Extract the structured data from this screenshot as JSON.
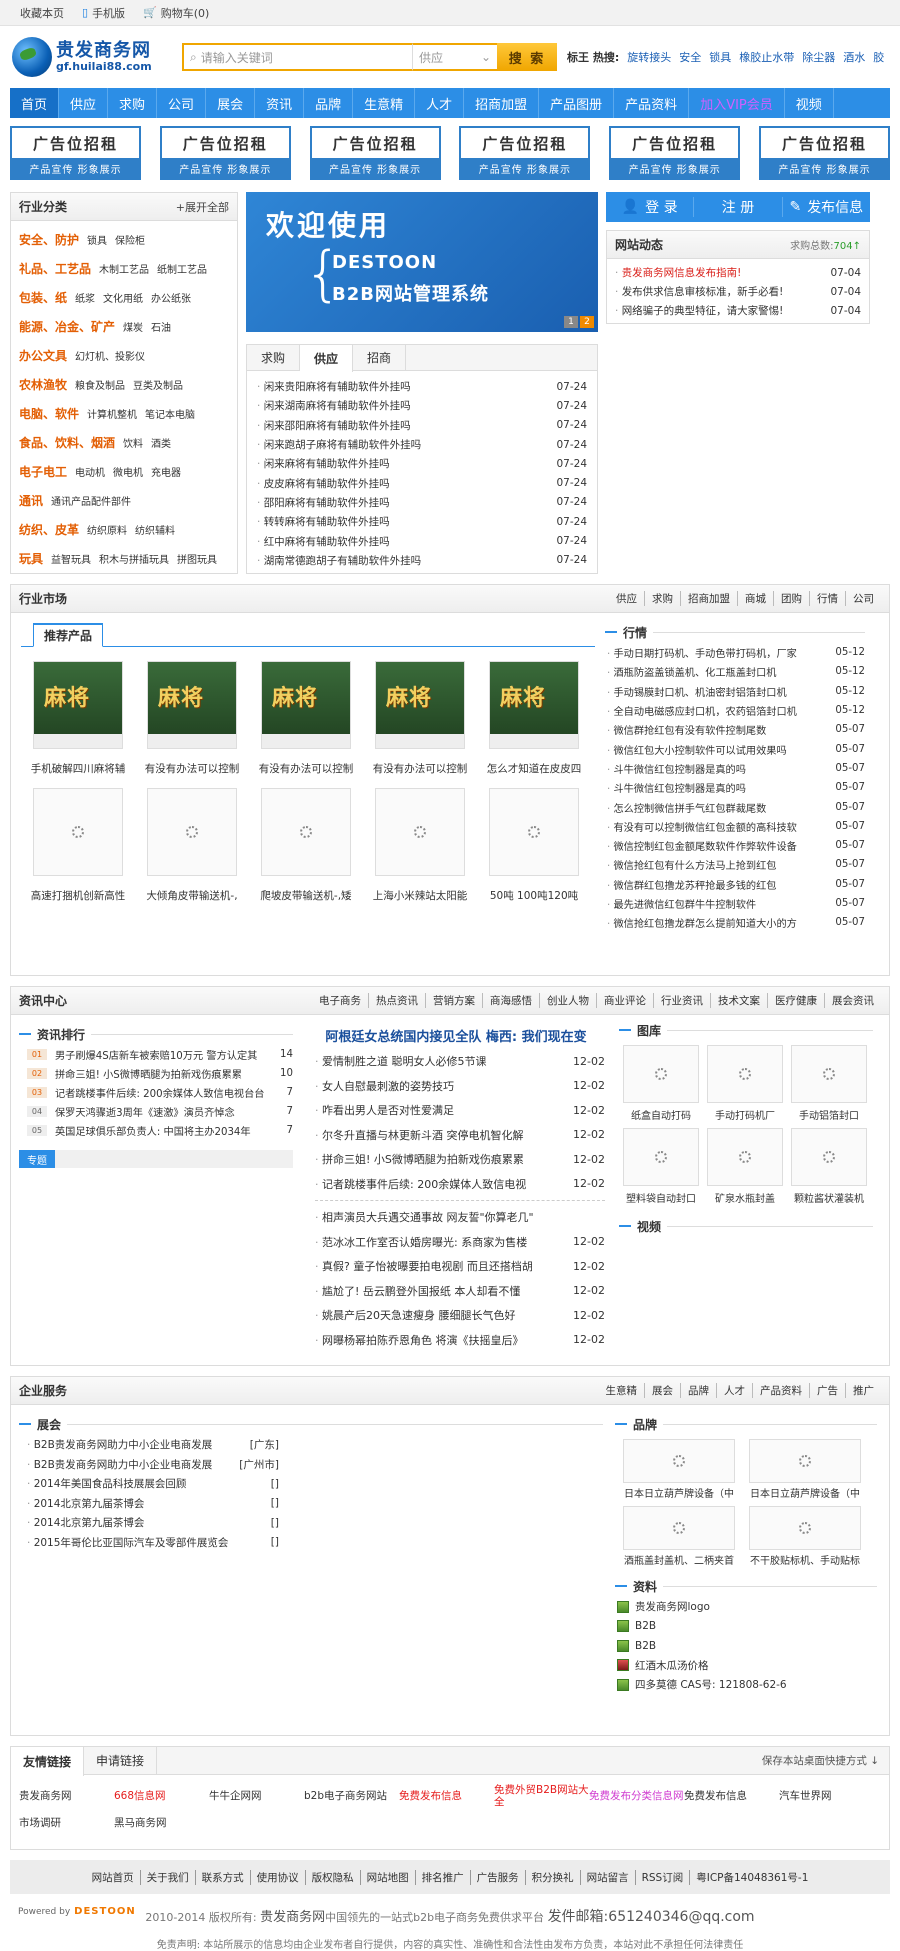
{
  "topbar": {
    "favorite": "收藏本页",
    "mobile": "手机版",
    "cart": "购物车(0)"
  },
  "logo": {
    "title": "贵发商务网",
    "domain": "gf.huilai88.com"
  },
  "search": {
    "placeholder": "请输入关键词",
    "type": "供应",
    "button": "搜 索",
    "hot_label": "标王 热搜:",
    "hot": [
      "旋转接头",
      "安全",
      "锁具",
      "橡胶止水带",
      "除尘器",
      "酒水",
      "胶"
    ]
  },
  "nav": [
    "首页",
    "供应",
    "求购",
    "公司",
    "展会",
    "资讯",
    "品牌",
    "生意精",
    "人才",
    "招商加盟",
    "产品图册",
    "产品资料",
    "加入VIP会员",
    "视频"
  ],
  "ads": {
    "title": "广告位招租",
    "sub": "产品宣传 形象展示",
    "count": 6
  },
  "category": {
    "title": "行业分类",
    "expand": "展开全部",
    "rows": [
      {
        "main": "安全、防护",
        "subs": [
          "锁具",
          "保险柜"
        ]
      },
      {
        "main": "礼品、工艺品",
        "subs": [
          "木制工艺品",
          "纸制工艺品"
        ]
      },
      {
        "main": "包装、纸",
        "subs": [
          "纸浆",
          "文化用纸",
          "办公纸张"
        ]
      },
      {
        "main": "能源、冶金、矿产",
        "subs": [
          "煤炭",
          "石油"
        ]
      },
      {
        "main": "办公文具",
        "subs": [
          "幻灯机、投影仪"
        ]
      },
      {
        "main": "农林渔牧",
        "subs": [
          "粮食及制品",
          "豆类及制品"
        ]
      },
      {
        "main": "电脑、软件",
        "subs": [
          "计算机整机",
          "笔记本电脑"
        ]
      },
      {
        "main": "食品、饮料、烟酒",
        "subs": [
          "饮料",
          "酒类"
        ]
      },
      {
        "main": "电子电工",
        "subs": [
          "电动机",
          "微电机",
          "充电器"
        ]
      },
      {
        "main": "通讯",
        "subs": [
          "通讯产品配件部件"
        ]
      },
      {
        "main": "纺织、皮革",
        "subs": [
          "纺织原料",
          "纺织辅料"
        ]
      },
      {
        "main": "玩具",
        "subs": [
          "益智玩具",
          "积木与拼插玩具",
          "拼图玩具"
        ]
      }
    ]
  },
  "banner": {
    "title": "欢迎使用",
    "line1": "DESTOON",
    "line2": "B2B网站管理系统",
    "pages": [
      "1",
      "2"
    ]
  },
  "trade_tabs": [
    "求购",
    "供应",
    "招商"
  ],
  "trade_list": [
    {
      "t": "闲来贵阳麻将有辅助软件外挂吗",
      "d": "07-24"
    },
    {
      "t": "闲来湖南麻将有辅助软件外挂吗",
      "d": "07-24"
    },
    {
      "t": "闲来邵阳麻将有辅助软件外挂吗",
      "d": "07-24"
    },
    {
      "t": "闲来跑胡子麻将有辅助软件外挂吗",
      "d": "07-24"
    },
    {
      "t": "闲来麻将有辅助软件外挂吗",
      "d": "07-24"
    },
    {
      "t": "皮皮麻将有辅助软件外挂吗",
      "d": "07-24"
    },
    {
      "t": "邵阳麻将有辅助软件外挂吗",
      "d": "07-24"
    },
    {
      "t": "转转麻将有辅助软件外挂吗",
      "d": "07-24"
    },
    {
      "t": "红中麻将有辅助软件外挂吗",
      "d": "07-24"
    },
    {
      "t": "湖南常德跑胡子有辅助软件外挂吗",
      "d": "07-24"
    }
  ],
  "account": {
    "login": "登 录",
    "register": "注 册",
    "publish": "发布信息"
  },
  "webdyn": {
    "title": "网站动态",
    "count_label": "求购总数:",
    "count": "704",
    "items": [
      {
        "t": "贵发商务网信息发布指南!",
        "d": "07-04",
        "red": true
      },
      {
        "t": "发布供求信息审核标准，新手必看!",
        "d": "07-04",
        "red": false
      },
      {
        "t": "网络骗子的典型特征，请大家警惕!",
        "d": "07-04",
        "red": false
      }
    ]
  },
  "market": {
    "title": "行业市场",
    "links": [
      "供应",
      "求购",
      "招商加盟",
      "商城",
      "团购",
      "行情",
      "公司"
    ],
    "tab": "推荐产品",
    "products": [
      {
        "t": "手机破解四川麻将辅",
        "img": true
      },
      {
        "t": "有没有办法可以控制",
        "img": true
      },
      {
        "t": "有没有办法可以控制",
        "img": true
      },
      {
        "t": "有没有办法可以控制",
        "img": true
      },
      {
        "t": "怎么才知道在皮皮四",
        "img": true
      },
      {
        "t": "高速打捆机创新高性",
        "img": false
      },
      {
        "t": "大倾角皮带输送机-,",
        "img": false
      },
      {
        "t": "爬坡皮带输送机-,矮",
        "img": false
      },
      {
        "t": "上海小米辣站太阳能",
        "img": false
      },
      {
        "t": "50吨 100吨120吨",
        "img": false
      }
    ],
    "product_image_text": "麻将",
    "quote_title": "行情",
    "quotes": [
      {
        "t": "手动日期打码机、手动色带打码机，厂家",
        "d": "05-12"
      },
      {
        "t": "酒瓶防盗盖锁盖机、化工瓶盖封口机",
        "d": "05-12"
      },
      {
        "t": "手动锡膜封口机、机油密封铝箔封口机",
        "d": "05-12"
      },
      {
        "t": "全自动电磁感应封口机，农药铝箔封口机",
        "d": "05-12"
      },
      {
        "t": "微信群抢红包有没有软件控制尾数",
        "d": "05-07"
      },
      {
        "t": "微信红包大小控制软件可以试用效果吗",
        "d": "05-07"
      },
      {
        "t": "斗牛微信红包控制器是真的吗",
        "d": "05-07"
      },
      {
        "t": "斗牛微信红包控制器是真的吗",
        "d": "05-07"
      },
      {
        "t": "怎么控制微信拼手气红包群裁尾数",
        "d": "05-07"
      },
      {
        "t": "有没有可以控制微信红包金额的高科技软",
        "d": "05-07"
      },
      {
        "t": "微信控制红包金额尾数软件作弊软件设备",
        "d": "05-07"
      },
      {
        "t": "微信抢红包有什么方法马上抢到红包",
        "d": "05-07"
      },
      {
        "t": "微信群红包撸龙苏秤抢最多钱的红包",
        "d": "05-07"
      },
      {
        "t": "最先进微信红包群牛牛控制软件",
        "d": "05-07"
      },
      {
        "t": "微信抢红包撸龙群怎么提前知道大小的方",
        "d": "05-07"
      }
    ]
  },
  "news": {
    "title": "资讯中心",
    "links": [
      "电子商务",
      "热点资讯",
      "营销方案",
      "商海感悟",
      "创业人物",
      "商业评论",
      "行业资讯",
      "技术文案",
      "医疗健康",
      "展会资讯"
    ],
    "rank_title": "资讯排行",
    "rank": [
      {
        "n": "01",
        "t": "男子刷爆4S店新车被索赔10万元 警方认定其",
        "c": "14"
      },
      {
        "n": "02",
        "t": "拼命三姐! 小S微博晒腿为拍新戏伤痕累累",
        "c": "10"
      },
      {
        "n": "03",
        "t": "记者跳楼事件后续: 200余媒体人致信电视台台",
        "c": "7"
      },
      {
        "n": "04",
        "t": "保罗天鸿骤逝3周年《速激》演员齐悼念",
        "c": "7"
      },
      {
        "n": "05",
        "t": "英国足球俱乐部负责人: 中国将主办2034年",
        "c": "7"
      }
    ],
    "topic_label": "专题",
    "headline": "阿根廷女总统国内接见全队 梅西: 我们现在变",
    "center": [
      {
        "t": "爱情制胜之道 聪明女人必修5节课",
        "d": "12-02"
      },
      {
        "t": "女人自慰最刺激的姿势技巧",
        "d": "12-02"
      },
      {
        "t": "咋看出男人是否对性爱满足",
        "d": "12-02"
      },
      {
        "t": "尔冬升直播与林更新斗酒 突停电机智化解",
        "d": "12-02"
      },
      {
        "t": "拼命三姐! 小S微博晒腿为拍新戏伤痕累累",
        "d": "12-02"
      },
      {
        "t": "记者跳楼事件后续: 200余媒体人致信电视",
        "d": "12-02"
      }
    ],
    "center2": [
      {
        "t": "相声演员大兵遇交通事故 网友誓\"你算老几\"",
        "d": ""
      },
      {
        "t": "范冰冰工作室否认婚房曝光: 系商家为售楼",
        "d": "12-02"
      },
      {
        "t": "真假? 童子怡被曝要拍电视剧 而且还搭档胡",
        "d": "12-02"
      },
      {
        "t": "尴尬了! 岳云鹏登外国报纸 本人却看不懂",
        "d": "12-02"
      },
      {
        "t": "姚晨产后20天急速瘦身 腰细腿长气色好",
        "d": "12-02"
      },
      {
        "t": "网曝杨幂拍陈乔恩角色 将演《扶摇皇后》",
        "d": "12-02"
      }
    ],
    "gallery_title": "图库",
    "gallery": [
      "纸盒自动打码",
      "手动打码机厂",
      "手动铝箔封口",
      "塑料袋自动封口",
      "矿泉水瓶封盖",
      "颗粒酱状灌装机"
    ],
    "video_title": "视频"
  },
  "service": {
    "title": "企业服务",
    "links": [
      "生意精",
      "展会",
      "品牌",
      "人才",
      "产品资料",
      "广告",
      "推广"
    ],
    "expo_title": "展会",
    "expos": [
      {
        "t": "B2B贵发商务网助力中小企业电商发展",
        "p": "[广东]"
      },
      {
        "t": "B2B贵发商务网助力中小企业电商发展",
        "p": "[广州市]"
      },
      {
        "t": "2014年美国食品科技展展会回顾",
        "p": "[]"
      },
      {
        "t": "2014北京第九届茶博会",
        "p": "[]"
      },
      {
        "t": "2014北京第九届茶博会",
        "p": "[]"
      },
      {
        "t": "2015年哥伦比亚国际汽车及零部件展览会",
        "p": "[]"
      }
    ],
    "brand_title": "品牌",
    "brands": [
      "日本日立葫芦牌设备（中",
      "日本日立葫芦牌设备（中",
      "酒瓶盖封盖机、二柄夹首",
      "不干胶贴标机、手动贴标"
    ],
    "doc_title": "资料",
    "docs": [
      "贵发商务网logo",
      "B2B",
      "B2B",
      "红酒木瓜汤价格",
      "四多莫德 CAS号: 121808-62-6"
    ]
  },
  "friends": {
    "tabs": [
      "友情链接",
      "申请链接"
    ],
    "save": "保存本站桌面快捷方式 ↓",
    "links": [
      {
        "t": "贵发商务网",
        "c": ""
      },
      {
        "t": "668信息网",
        "c": "r"
      },
      {
        "t": "牛牛企网网",
        "c": ""
      },
      {
        "t": "b2b电子商务网站",
        "c": ""
      },
      {
        "t": "免费发布信息",
        "c": "r"
      },
      {
        "t": "免费外贸B2B网站大全",
        "c": "r"
      },
      {
        "t": "免费发布分类信息网",
        "c": "m"
      },
      {
        "t": "免费发布信息",
        "c": ""
      },
      {
        "t": "汽车世界网",
        "c": ""
      },
      {
        "t": "市场调研",
        "c": ""
      },
      {
        "t": "黑马商务网",
        "c": ""
      }
    ]
  },
  "footer": {
    "nav": [
      "网站首页",
      "关于我们",
      "联系方式",
      "使用协议",
      "版权隐私",
      "网站地图",
      "排名推广",
      "广告服务",
      "积分换礼",
      "网站留言",
      "RSS订阅",
      "粤ICP备14048361号-1"
    ],
    "copy_pre": "2010-2014 版权所有:",
    "copy_site": "贵发商务网",
    "copy_desc": "中国领先的一站式b2b电子商务免费供求平台",
    "mail_label": "发件邮箱:",
    "mail": "651240346@qq.com",
    "disclaimer": "免责声明: 本站所展示的信息均由企业发布者自行提供，内容的真实性、准确性和合法性由发布方负责，本站对此不承担任何法律责任",
    "powered": "Powered by",
    "powered_brand": "DESTOON"
  }
}
